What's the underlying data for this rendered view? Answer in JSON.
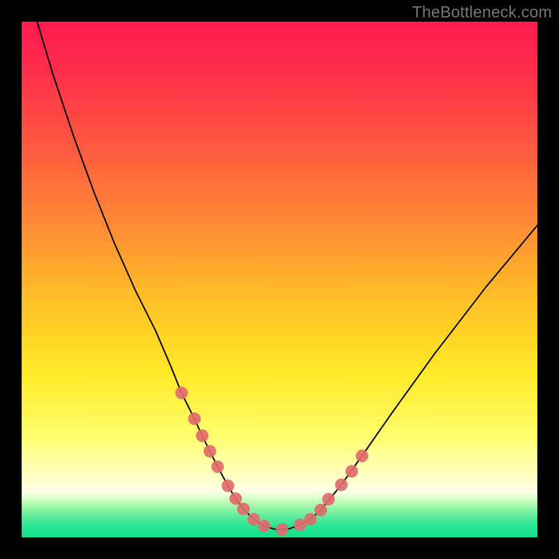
{
  "watermark": "TheBottleneck.com",
  "chart_data": {
    "type": "line",
    "title": "",
    "xlabel": "",
    "ylabel": "",
    "xlim": [
      0,
      100
    ],
    "ylim": [
      0,
      100
    ],
    "series": [
      {
        "name": "bottleneck-curve",
        "x": [
          3,
          6,
          10,
          14,
          18,
          22,
          26,
          29,
          31,
          33.5,
          35,
          36.5,
          38,
          40,
          41.5,
          43,
          45,
          47,
          49,
          50.5,
          52,
          54,
          56,
          58,
          62,
          66,
          72,
          80,
          90,
          100
        ],
        "y": [
          100,
          90,
          78,
          67,
          57,
          48,
          40,
          33,
          28,
          23,
          19.7,
          16.7,
          13.7,
          10.0,
          7.5,
          5.5,
          3.5,
          2.2,
          1.6,
          1.5,
          1.7,
          2.4,
          3.5,
          5.3,
          10.2,
          15.8,
          24.4,
          35.5,
          48.5,
          60.5
        ]
      }
    ],
    "markers": {
      "name": "data-points",
      "x": [
        31.0,
        33.5,
        35.0,
        36.5,
        38.0,
        40.0,
        41.5,
        43.0,
        45.0,
        47.0,
        50.5,
        54.0,
        56.0,
        58.0,
        59.5,
        62.0,
        64.0,
        66.0
      ],
      "y": [
        28.0,
        23.0,
        19.7,
        16.7,
        13.7,
        10.0,
        7.5,
        5.5,
        3.5,
        2.2,
        1.5,
        2.4,
        3.5,
        5.3,
        7.4,
        10.2,
        12.8,
        15.8
      ]
    },
    "colors": {
      "curve": "#000000",
      "marker_fill": "#e16b6c",
      "gradient_top": "#ff1a4e",
      "gradient_mid": "#ffe825",
      "gradient_bottom": "#14df8b"
    }
  }
}
